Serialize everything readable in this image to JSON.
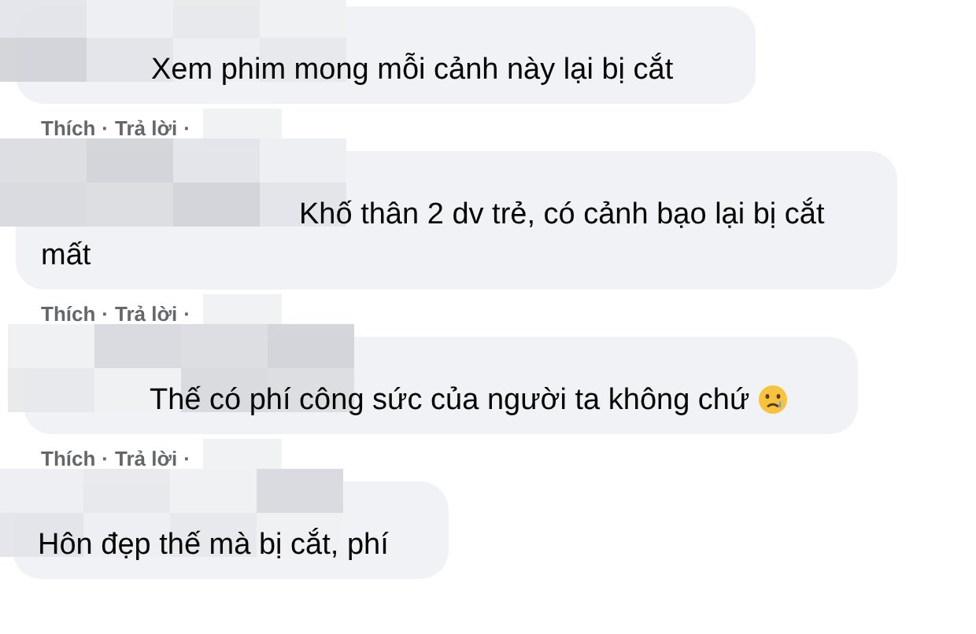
{
  "separator": "·",
  "comments": [
    {
      "kind": "plain",
      "text": "Xem phim mong mỗi cảnh này lại bị cắt",
      "actions": [
        "Thích",
        "Trả lời"
      ]
    },
    {
      "kind": "plain",
      "text": "Khố thân 2 dv trẻ, có cảnh bạo lại bị cắt mất",
      "actions": [
        "Thích",
        "Trả lời"
      ]
    },
    {
      "kind": "with-emoji",
      "text": "Thế có phí công sức của người ta không chứ",
      "actions": [
        "Thích",
        "Trả lời"
      ]
    },
    {
      "kind": "plain",
      "text": "Hôn đẹp thế mà bị cắt, phí"
    }
  ]
}
